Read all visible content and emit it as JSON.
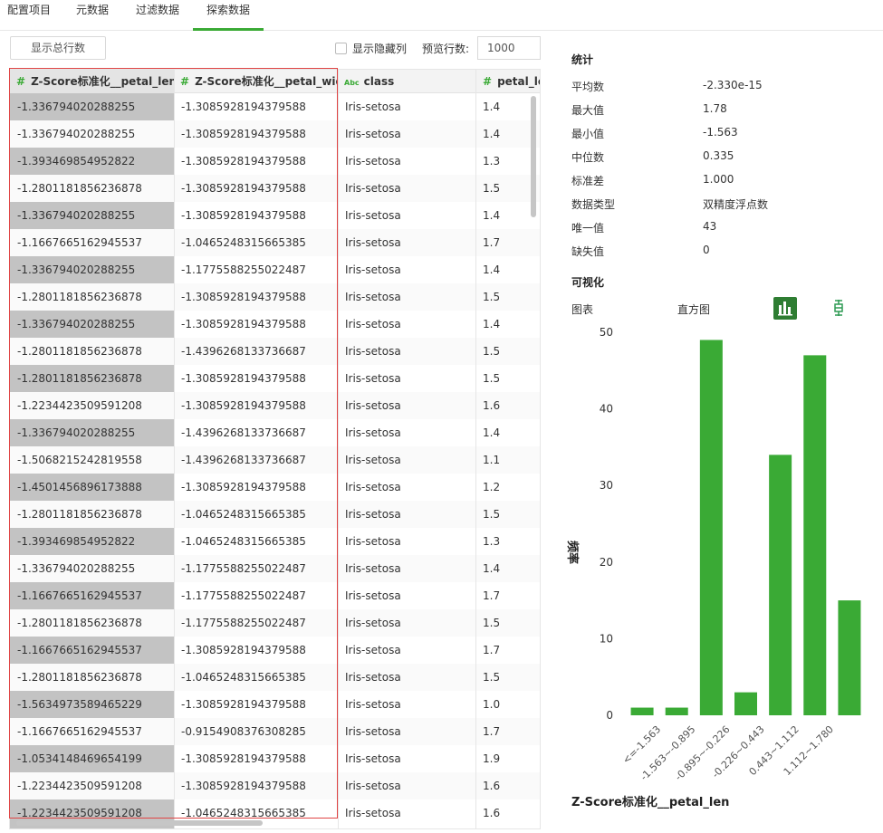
{
  "tabs": [
    {
      "label": "配置项目",
      "active": false
    },
    {
      "label": "元数据",
      "active": false
    },
    {
      "label": "过滤数据",
      "active": false
    },
    {
      "label": "探索数据",
      "active": true
    }
  ],
  "toolbar": {
    "show_rows_label": "显示总行数",
    "show_hidden_label": "显示隐藏列",
    "preview_rows_label": "预览行数:",
    "preview_rows_value": "1000"
  },
  "table": {
    "columns": [
      {
        "name": "Z-Score标准化__petal_len",
        "type": "#"
      },
      {
        "name": "Z-Score标准化__petal_wid",
        "type": "#"
      },
      {
        "name": "class",
        "type": "Abc"
      },
      {
        "name": "petal_len",
        "type": "#"
      }
    ],
    "rows": [
      [
        "-1.336794020288255",
        "-1.3085928194379588",
        "Iris-setosa",
        "1.4"
      ],
      [
        "-1.336794020288255",
        "-1.3085928194379588",
        "Iris-setosa",
        "1.4"
      ],
      [
        "-1.393469854952822",
        "-1.3085928194379588",
        "Iris-setosa",
        "1.3"
      ],
      [
        "-1.2801181856236878",
        "-1.3085928194379588",
        "Iris-setosa",
        "1.5"
      ],
      [
        "-1.336794020288255",
        "-1.3085928194379588",
        "Iris-setosa",
        "1.4"
      ],
      [
        "-1.1667665162945537",
        "-1.0465248315665385",
        "Iris-setosa",
        "1.7"
      ],
      [
        "-1.336794020288255",
        "-1.1775588255022487",
        "Iris-setosa",
        "1.4"
      ],
      [
        "-1.2801181856236878",
        "-1.3085928194379588",
        "Iris-setosa",
        "1.5"
      ],
      [
        "-1.336794020288255",
        "-1.3085928194379588",
        "Iris-setosa",
        "1.4"
      ],
      [
        "-1.2801181856236878",
        "-1.4396268133736687",
        "Iris-setosa",
        "1.5"
      ],
      [
        "-1.2801181856236878",
        "-1.3085928194379588",
        "Iris-setosa",
        "1.5"
      ],
      [
        "-1.2234423509591208",
        "-1.3085928194379588",
        "Iris-setosa",
        "1.6"
      ],
      [
        "-1.336794020288255",
        "-1.4396268133736687",
        "Iris-setosa",
        "1.4"
      ],
      [
        "-1.5068215242819558",
        "-1.4396268133736687",
        "Iris-setosa",
        "1.1"
      ],
      [
        "-1.4501456896173888",
        "-1.3085928194379588",
        "Iris-setosa",
        "1.2"
      ],
      [
        "-1.2801181856236878",
        "-1.0465248315665385",
        "Iris-setosa",
        "1.5"
      ],
      [
        "-1.393469854952822",
        "-1.0465248315665385",
        "Iris-setosa",
        "1.3"
      ],
      [
        "-1.336794020288255",
        "-1.1775588255022487",
        "Iris-setosa",
        "1.4"
      ],
      [
        "-1.1667665162945537",
        "-1.1775588255022487",
        "Iris-setosa",
        "1.7"
      ],
      [
        "-1.2801181856236878",
        "-1.1775588255022487",
        "Iris-setosa",
        "1.5"
      ],
      [
        "-1.1667665162945537",
        "-1.3085928194379588",
        "Iris-setosa",
        "1.7"
      ],
      [
        "-1.2801181856236878",
        "-1.0465248315665385",
        "Iris-setosa",
        "1.5"
      ],
      [
        "-1.5634973589465229",
        "-1.3085928194379588",
        "Iris-setosa",
        "1.0"
      ],
      [
        "-1.1667665162945537",
        "-0.9154908376308285",
        "Iris-setosa",
        "1.7"
      ],
      [
        "-1.0534148469654199",
        "-1.3085928194379588",
        "Iris-setosa",
        "1.9"
      ],
      [
        "-1.2234423509591208",
        "-1.3085928194379588",
        "Iris-setosa",
        "1.6"
      ],
      [
        "-1.2234423509591208",
        "-1.0465248315665385",
        "Iris-setosa",
        "1.6"
      ]
    ]
  },
  "stats": {
    "title": "统计",
    "items": [
      {
        "label": "平均数",
        "value": "-2.330e-15"
      },
      {
        "label": "最大值",
        "value": "1.78"
      },
      {
        "label": "最小值",
        "value": "-1.563"
      },
      {
        "label": "中位数",
        "value": "0.335"
      },
      {
        "label": "标准差",
        "value": "1.000"
      },
      {
        "label": "数据类型",
        "value": "双精度浮点数"
      },
      {
        "label": "唯一值",
        "value": "43"
      },
      {
        "label": "缺失值",
        "value": "0"
      }
    ]
  },
  "visualization": {
    "title": "可视化",
    "chart_label": "图表",
    "chart_type_label": "直方图",
    "bar_icon": "bar-chart-icon",
    "box_icon": "boxplot-icon",
    "accent": "#3aaa35"
  },
  "chart_data": {
    "type": "bar",
    "categories": [
      "<=-1.563",
      "-1.563~-0.895",
      "-0.895~-0.226",
      "-0.226~0.443",
      "0.443~1.112",
      "1.112~1.780"
    ],
    "values": [
      1,
      1,
      49,
      3,
      34,
      47,
      15
    ],
    "bar_labels_note": "",
    "ylabel": "频率",
    "xlabel": "Z-Score标准化__petal_len",
    "ylim": [
      0,
      50
    ],
    "yticks": [
      0,
      10,
      20,
      30,
      40,
      50
    ],
    "color": "#3aaa35"
  }
}
